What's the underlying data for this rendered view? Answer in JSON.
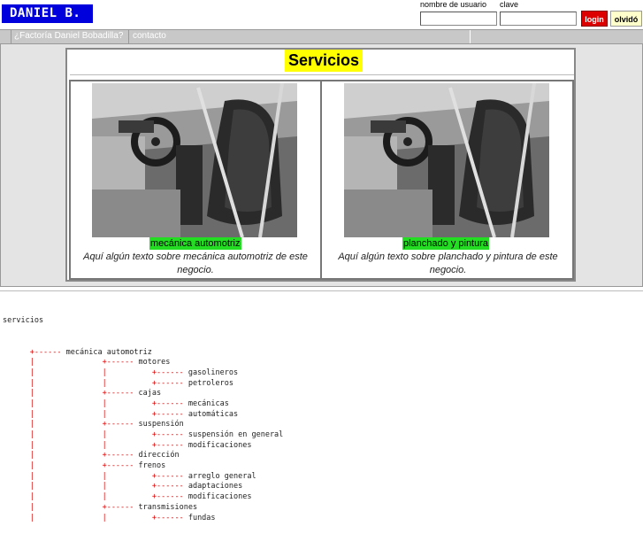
{
  "header": {
    "logo": "DANIEL B.",
    "username_label": "nombre de usuario",
    "password_label": "clave",
    "username_value": "",
    "password_value": "",
    "login_button": "login",
    "forgot_button": "olvidó"
  },
  "nav": {
    "items": [
      "¿Factoría Daniel Bobadilla?",
      "contacto"
    ]
  },
  "services": {
    "title": "Servicios",
    "items": [
      {
        "name": "mecánica automotriz",
        "description_line1": "Aquí algún texto sobre mecánica automotriz de este",
        "description_line2": "negocio."
      },
      {
        "name": "planchado y pintura",
        "description_line1": "Aquí algún texto sobre planchado y pintura de este negocio.",
        "description_line2": ""
      }
    ]
  },
  "sitemap": {
    "root": "servicios",
    "rows": [
      {
        "prefix": "      ",
        "branch": "+------ ",
        "label": "mecánica automotriz",
        "level": 1
      },
      {
        "prefix": "      |               ",
        "branch": "+------ ",
        "label": "motores",
        "level": 2
      },
      {
        "prefix": "      |               |          ",
        "branch": "+------ ",
        "label": "gasolineros",
        "level": 3
      },
      {
        "prefix": "      |               |          ",
        "branch": "+------ ",
        "label": "petroleros",
        "level": 3
      },
      {
        "prefix": "      |               ",
        "branch": "+------ ",
        "label": "cajas",
        "level": 2
      },
      {
        "prefix": "      |               |          ",
        "branch": "+------ ",
        "label": "mecánicas",
        "level": 3
      },
      {
        "prefix": "      |               |          ",
        "branch": "+------ ",
        "label": "automáticas",
        "level": 3
      },
      {
        "prefix": "      |               ",
        "branch": "+------ ",
        "label": "suspensión",
        "level": 2
      },
      {
        "prefix": "      |               |          ",
        "branch": "+------ ",
        "label": "suspensión en general",
        "level": 3
      },
      {
        "prefix": "      |               |          ",
        "branch": "+------ ",
        "label": "modificaciones",
        "level": 3
      },
      {
        "prefix": "      |               ",
        "branch": "+------ ",
        "label": "dirección",
        "level": 2
      },
      {
        "prefix": "      |               ",
        "branch": "+------ ",
        "label": "frenos",
        "level": 2
      },
      {
        "prefix": "      |               |          ",
        "branch": "+------ ",
        "label": "arreglo general",
        "level": 3
      },
      {
        "prefix": "      |               |          ",
        "branch": "+------ ",
        "label": "adaptaciones",
        "level": 3
      },
      {
        "prefix": "      |               |          ",
        "branch": "+------ ",
        "label": "modificaciones",
        "level": 3
      },
      {
        "prefix": "      |               ",
        "branch": "+------ ",
        "label": "transmisiones",
        "level": 2
      },
      {
        "prefix": "      |               |          ",
        "branch": "+------ ",
        "label": "fundas",
        "level": 3
      }
    ]
  },
  "colors": {
    "logo_bg": "#0000dd",
    "login_bg": "#dd0000",
    "title_highlight": "#ffff00",
    "service_name_highlight": "#22dd22",
    "tree_branch": "#dd0000"
  }
}
